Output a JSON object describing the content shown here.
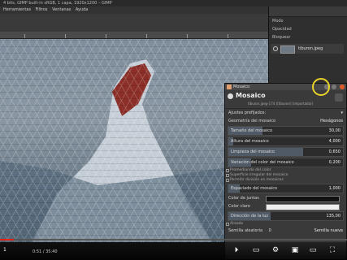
{
  "window": {
    "title": "4 bits, GIMP built-in sRGB, 1 capa, 1920x1200 – GIMP"
  },
  "menu": [
    "Herramientas",
    "Filtros",
    "Ventanas",
    "Ayuda"
  ],
  "dock": {
    "tab_label": "Modo",
    "opacity_label": "Opacidad",
    "lock_label": "Bloquear",
    "layer_name": "tiburon.jpeg"
  },
  "dialog": {
    "window_title": "Mosaico",
    "name": "Mosaico",
    "subtitle": "tiburon.jpeg-174 ([tiburon] (importada))",
    "presets_label": "Ajustes prefijados:",
    "geometry_label": "Geometría del mosaico",
    "geometry_value": "Hexágonos",
    "params": [
      {
        "label": "Tamaño del mosaico",
        "value": "30,00",
        "fraction": 0.3
      },
      {
        "label": "Altura del mosaico",
        "value": "4,000",
        "fraction": 0.04
      },
      {
        "label": "Limpieza del mosaico",
        "value": "0,650",
        "fraction": 0.65
      },
      {
        "label": "Variación del color del mosaico",
        "value": "0,200",
        "fraction": 0.2
      }
    ],
    "checks": [
      "Promediando del color",
      "Superficie irregular del mosaico",
      "Permitir división en mosaicos"
    ],
    "spacing": {
      "label": "Espaciado del mosaico",
      "value": "1,000",
      "fraction": 0.1
    },
    "colors": [
      {
        "label": "Color de juntas",
        "color": "#111111"
      },
      {
        "label": "Color claro",
        "color": "#eeeeee"
      }
    ],
    "light_dir": {
      "label": "Dirección de la luz",
      "value": "135,00",
      "fraction": 0.37
    },
    "seed_label": "Semilla aleatoria",
    "seed_value": "0",
    "new_seed": "Semilla nueva",
    "antialias_label": "Alisado"
  },
  "player": {
    "time": "0:51 / 35:40",
    "progress": 0.04,
    "status": "1"
  }
}
